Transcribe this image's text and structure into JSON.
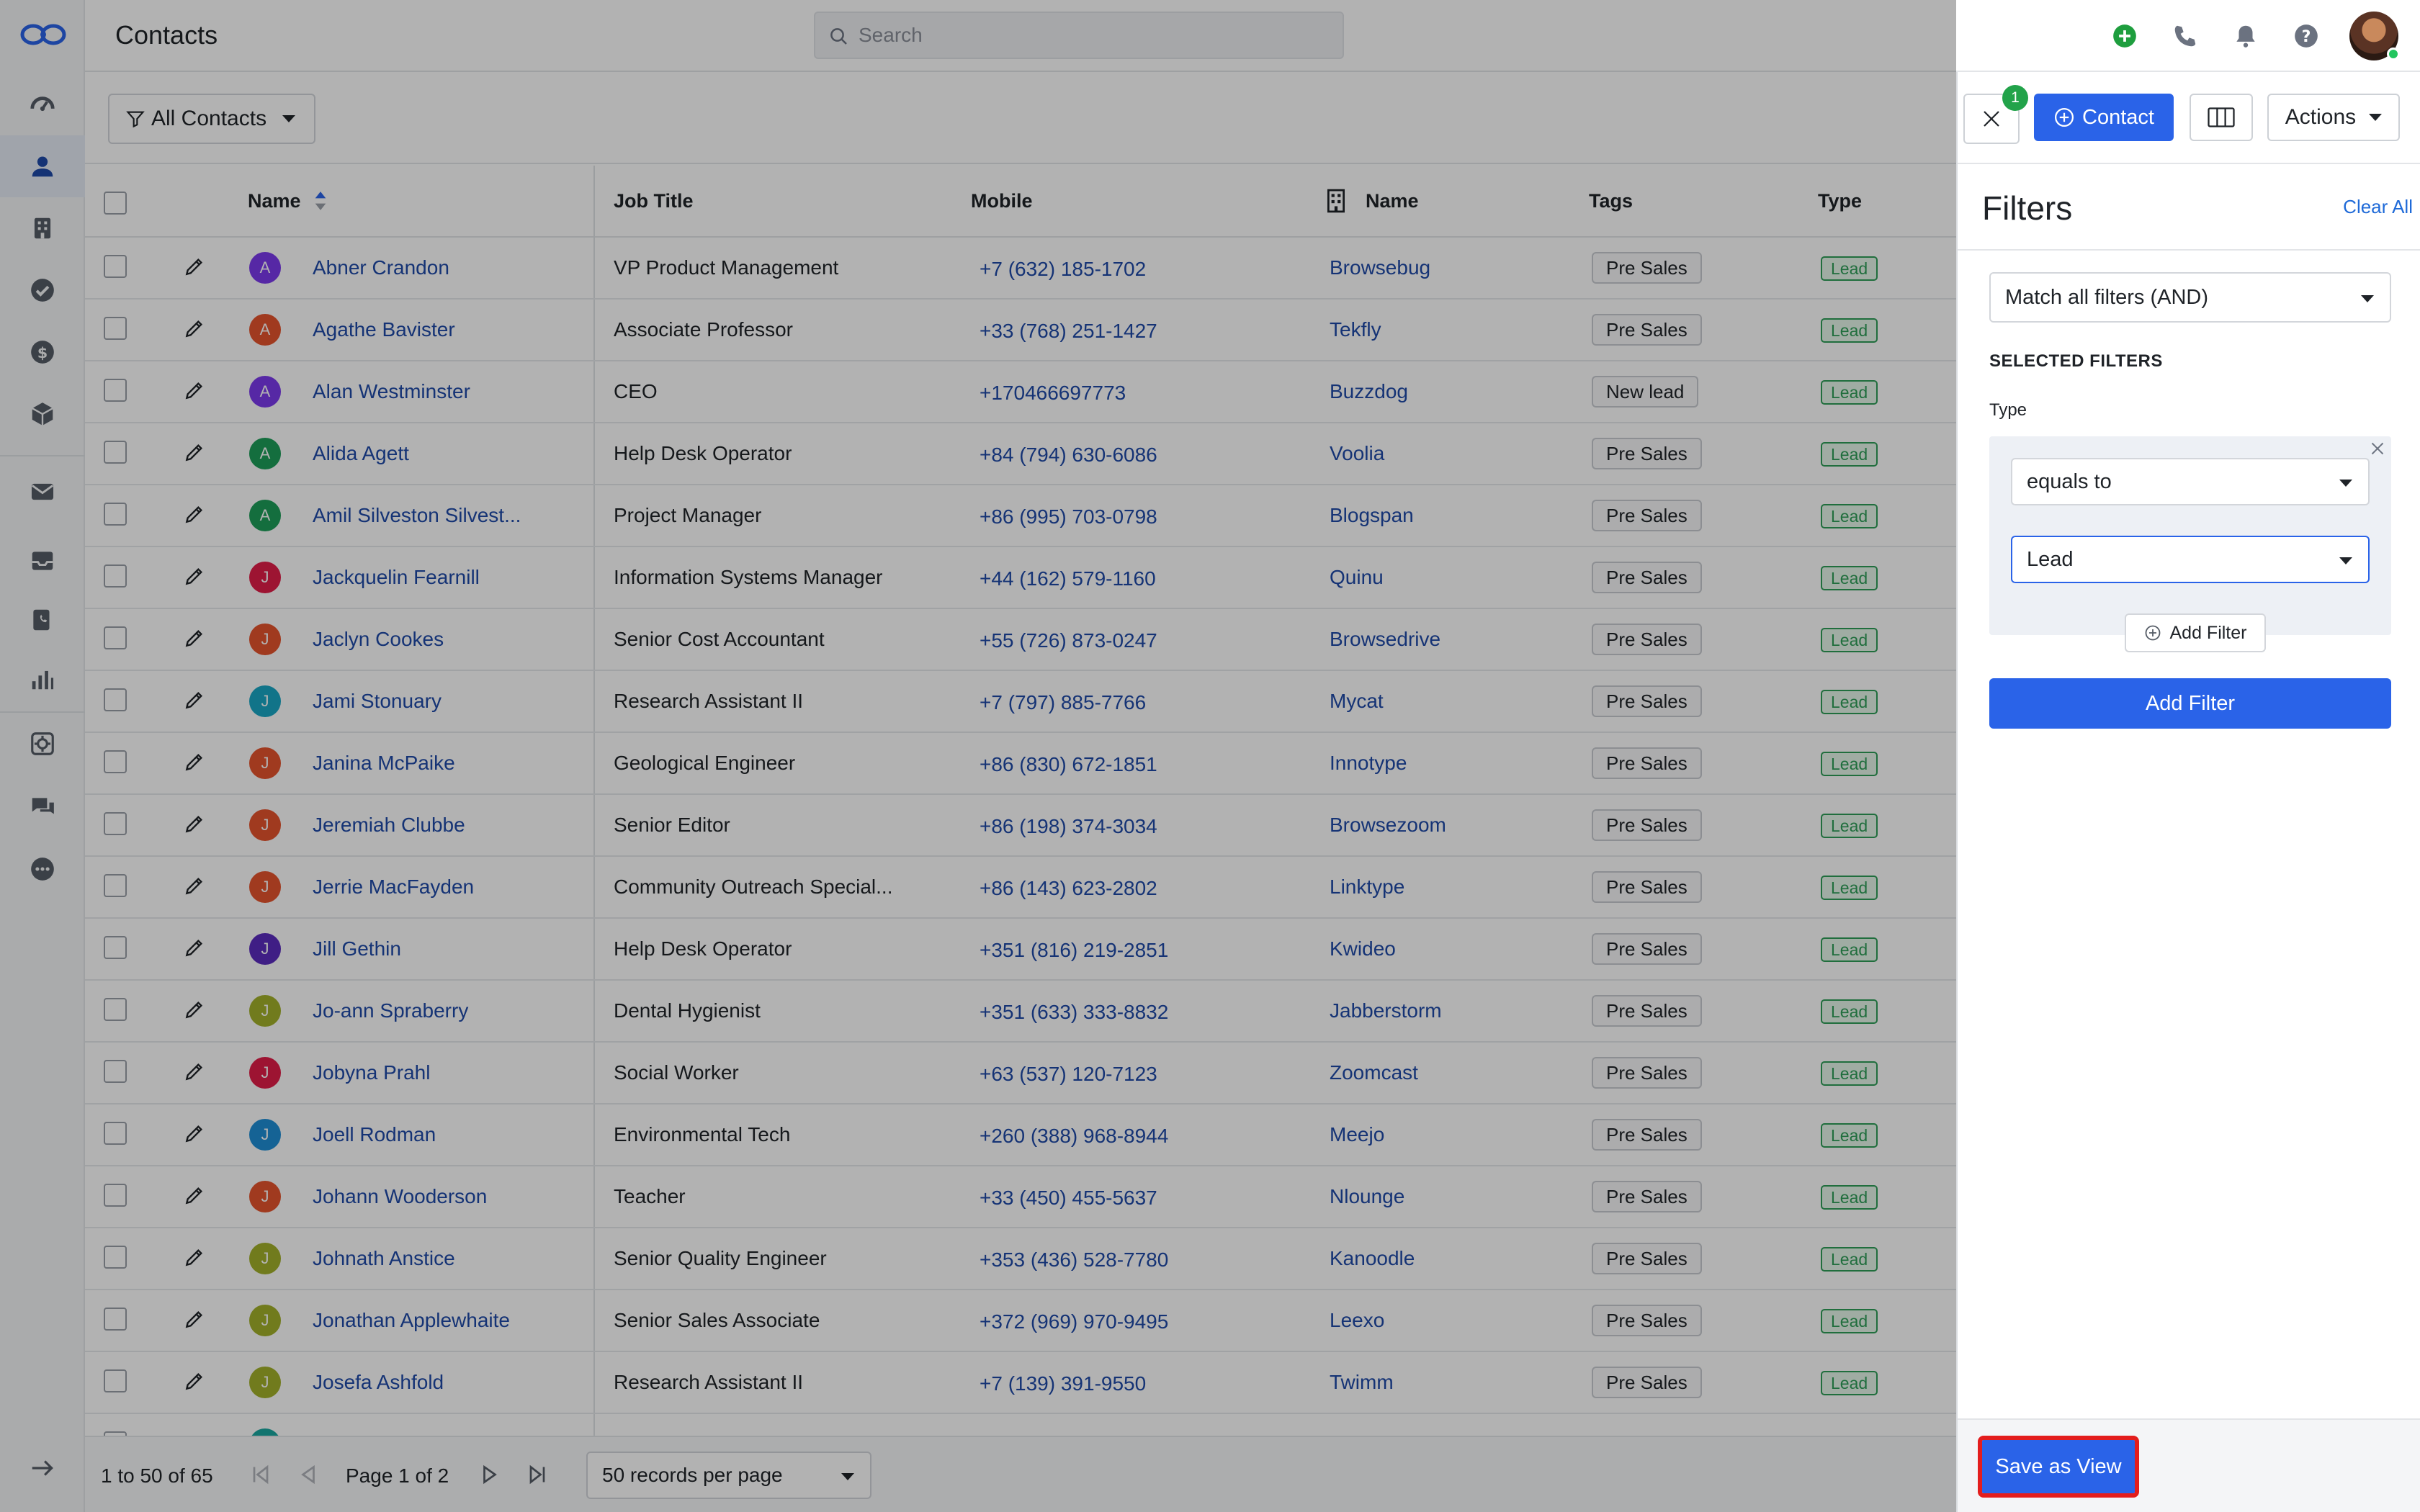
{
  "header": {
    "title": "Contacts",
    "search_placeholder": "Search"
  },
  "toolbar": {
    "view_label": "All Contacts"
  },
  "table": {
    "columns": [
      "Name",
      "Job Title",
      "Mobile",
      "Name",
      "Tags",
      "Type"
    ],
    "rows": [
      {
        "initial": "A",
        "color": "#7c3aed",
        "name": "Abner Crandon",
        "job": "VP Product Management",
        "mobile": "+7 (632) 185-1702",
        "company": "Browsebug",
        "tag": "Pre Sales",
        "type": "Lead"
      },
      {
        "initial": "A",
        "color": "#e5532d",
        "name": "Agathe Bavister",
        "job": "Associate Professor",
        "mobile": "+33 (768) 251-1427",
        "company": "Tekfly",
        "tag": "Pre Sales",
        "type": "Lead"
      },
      {
        "initial": "A",
        "color": "#7c3aed",
        "name": "Alan Westminster",
        "job": "CEO",
        "mobile": "+170466697773",
        "company": "Buzzdog",
        "tag": "New lead",
        "type": "Lead"
      },
      {
        "initial": "A",
        "color": "#1e9e5a",
        "name": "Alida Agett",
        "job": "Help Desk Operator",
        "mobile": "+84 (794) 630-6086",
        "company": "Voolia",
        "tag": "Pre Sales",
        "type": "Lead"
      },
      {
        "initial": "A",
        "color": "#1e9e5a",
        "name": "Amil Silveston Silvest...",
        "job": "Project Manager",
        "mobile": "+86 (995) 703-0798",
        "company": "Blogspan",
        "tag": "Pre Sales",
        "type": "Lead"
      },
      {
        "initial": "J",
        "color": "#e11d48",
        "name": "Jackquelin Fearnill",
        "job": "Information Systems Manager",
        "mobile": "+44 (162) 579-1160",
        "company": "Quinu",
        "tag": "Pre Sales",
        "type": "Lead"
      },
      {
        "initial": "J",
        "color": "#e5532d",
        "name": "Jaclyn Cookes",
        "job": "Senior Cost Accountant",
        "mobile": "+55 (726) 873-0247",
        "company": "Browsedrive",
        "tag": "Pre Sales",
        "type": "Lead"
      },
      {
        "initial": "J",
        "color": "#19a7c4",
        "name": "Jami Stonuary",
        "job": "Research Assistant II",
        "mobile": "+7 (797) 885-7766",
        "company": "Mycat",
        "tag": "Pre Sales",
        "type": "Lead"
      },
      {
        "initial": "J",
        "color": "#e5532d",
        "name": "Janina McPaike",
        "job": "Geological Engineer",
        "mobile": "+86 (830) 672-1851",
        "company": "Innotype",
        "tag": "Pre Sales",
        "type": "Lead"
      },
      {
        "initial": "J",
        "color": "#e5532d",
        "name": "Jeremiah Clubbe",
        "job": "Senior Editor",
        "mobile": "+86 (198) 374-3034",
        "company": "Browsezoom",
        "tag": "Pre Sales",
        "type": "Lead"
      },
      {
        "initial": "J",
        "color": "#e5532d",
        "name": "Jerrie MacFayden",
        "job": "Community Outreach Special...",
        "mobile": "+86 (143) 623-2802",
        "company": "Linktype",
        "tag": "Pre Sales",
        "type": "Lead"
      },
      {
        "initial": "J",
        "color": "#5b2bbf",
        "name": "Jill Gethin",
        "job": "Help Desk Operator",
        "mobile": "+351 (816) 219-2851",
        "company": "Kwideo",
        "tag": "Pre Sales",
        "type": "Lead"
      },
      {
        "initial": "J",
        "color": "#a3b12a",
        "name": "Jo-ann Spraberry",
        "job": "Dental Hygienist",
        "mobile": "+351 (633) 333-8832",
        "company": "Jabberstorm",
        "tag": "Pre Sales",
        "type": "Lead"
      },
      {
        "initial": "J",
        "color": "#e11d48",
        "name": "Jobyna Prahl",
        "job": "Social Worker",
        "mobile": "+63 (537) 120-7123",
        "company": "Zoomcast",
        "tag": "Pre Sales",
        "type": "Lead"
      },
      {
        "initial": "J",
        "color": "#1f8fd6",
        "name": "Joell Rodman",
        "job": "Environmental Tech",
        "mobile": "+260 (388) 968-8944",
        "company": "Meejo",
        "tag": "Pre Sales",
        "type": "Lead"
      },
      {
        "initial": "J",
        "color": "#e5532d",
        "name": "Johann Wooderson",
        "job": "Teacher",
        "mobile": "+33 (450) 455-5637",
        "company": "Nlounge",
        "tag": "Pre Sales",
        "type": "Lead"
      },
      {
        "initial": "J",
        "color": "#a3b12a",
        "name": "Johnath Anstice",
        "job": "Senior Quality Engineer",
        "mobile": "+353 (436) 528-7780",
        "company": "Kanoodle",
        "tag": "Pre Sales",
        "type": "Lead"
      },
      {
        "initial": "J",
        "color": "#a3b12a",
        "name": "Jonathan Applewhaite",
        "job": "Senior Sales Associate",
        "mobile": "+372 (969) 970-9495",
        "company": "Leexo",
        "tag": "Pre Sales",
        "type": "Lead"
      },
      {
        "initial": "J",
        "color": "#a3b12a",
        "name": "Josefa Ashfold",
        "job": "Research Assistant II",
        "mobile": "+7 (139) 391-9550",
        "company": "Twimm",
        "tag": "Pre Sales",
        "type": "Lead"
      }
    ]
  },
  "pager": {
    "range": "1 to 50 of 65",
    "page": "Page 1 of 2",
    "per_page": "50 records per page"
  },
  "panel": {
    "badge": "1",
    "contact_label": "Contact",
    "actions_label": "Actions",
    "filters_title": "Filters",
    "clear_all": "Clear All",
    "match_mode": "Match all filters (AND)",
    "selected_filters_label": "SELECTED FILTERS",
    "field_label": "Type",
    "operator": "equals to",
    "value": "Lead",
    "add_filter_small": "Add Filter",
    "add_filter_big": "Add Filter",
    "save_as_view": "Save as View"
  },
  "colors": {
    "primary": "#2a63e8",
    "highlight": "#e31d1d",
    "lead": "#2f9e58"
  }
}
